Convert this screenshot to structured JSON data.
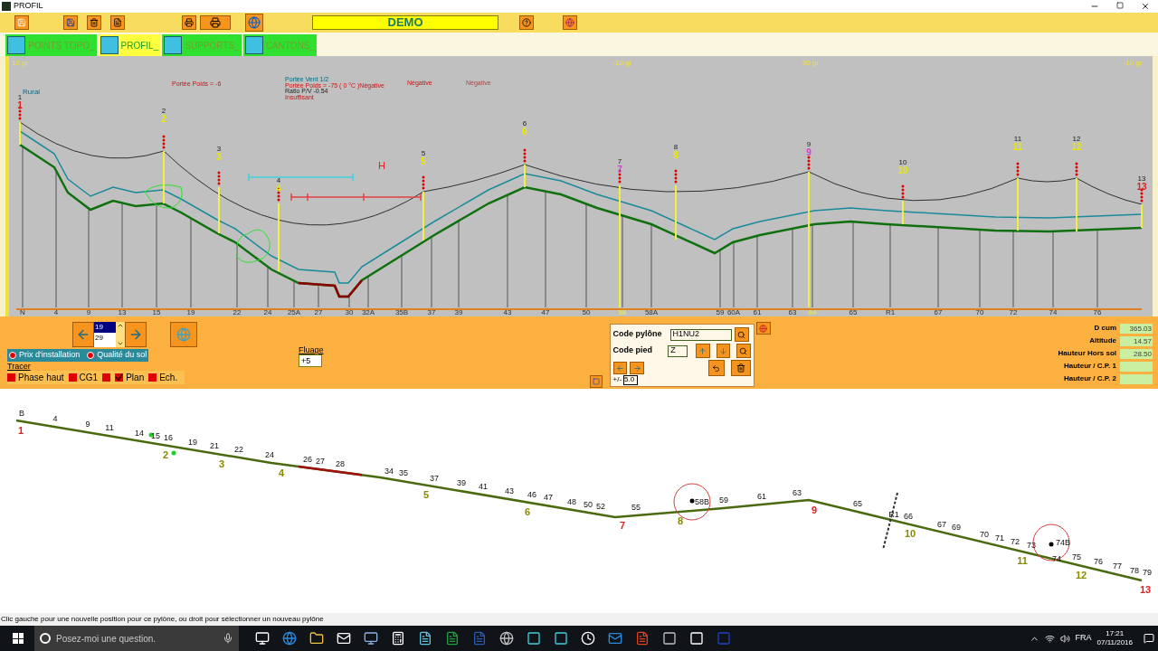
{
  "window": {
    "title": "PROFIL"
  },
  "toolbar": {
    "badge": "DEMO"
  },
  "tabs": [
    {
      "label": "POINTS TOPO_",
      "selected": false
    },
    {
      "label": "PROFIL_",
      "selected": true
    },
    {
      "label": "SUPPORTS_",
      "selected": false
    },
    {
      "label": "CANTONS_",
      "selected": false
    }
  ],
  "profile": {
    "grade_labels": [
      "10 gr",
      "-10 gr",
      "20 gr",
      "-10 gr"
    ],
    "annotations": [
      {
        "text": "Portée Poids = -6",
        "kind": "alert"
      },
      {
        "text": "Portée Vent 1/2",
        "kind": "wind"
      },
      {
        "text": "Portée Poids = -75  (  0 °C )Négative",
        "kind": "alert"
      },
      {
        "text": "Ratio P/V -0.54",
        "kind": "info"
      },
      {
        "text": "Insuffisant",
        "kind": "alert"
      },
      {
        "text": "Négative",
        "kind": "alert"
      },
      {
        "text": "Négative",
        "kind": "faint"
      }
    ],
    "zone_label": "Rural",
    "marker": "H",
    "towers": [
      {
        "number": "1",
        "code": "1",
        "color": "#e02020"
      },
      {
        "number": "2",
        "code": "2",
        "color": "#e8e800"
      },
      {
        "number": "3",
        "code": "3",
        "color": "#e8e800"
      },
      {
        "number": "4",
        "code": "4",
        "color": "#e8e800"
      },
      {
        "number": "5",
        "code": "5",
        "color": "#e8e800"
      },
      {
        "number": "6",
        "code": "6",
        "color": "#e8e800"
      },
      {
        "number": "7",
        "code": "7",
        "color": "#d040d0"
      },
      {
        "number": "8",
        "code": "8",
        "color": "#e8e800"
      },
      {
        "number": "9",
        "code": "9",
        "color": "#d040d0"
      },
      {
        "number": "10",
        "code": "10",
        "color": "#e8e800"
      },
      {
        "number": "11",
        "code": "11",
        "color": "#e8e800"
      },
      {
        "number": "12",
        "code": "12",
        "color": "#e8e800"
      },
      {
        "number": "13",
        "code": "13",
        "color": "#e02020"
      }
    ],
    "stations": [
      {
        "label": "N",
        "highlighted": false
      },
      {
        "label": "4",
        "highlighted": false
      },
      {
        "label": "9",
        "highlighted": false
      },
      {
        "label": "13",
        "highlighted": false
      },
      {
        "label": "15",
        "highlighted": false
      },
      {
        "label": "19",
        "highlighted": false
      },
      {
        "label": "22",
        "highlighted": false
      },
      {
        "label": "24",
        "highlighted": false
      },
      {
        "label": "25A",
        "highlighted": false
      },
      {
        "label": "27",
        "highlighted": false
      },
      {
        "label": "30",
        "highlighted": false
      },
      {
        "label": "32A",
        "highlighted": false
      },
      {
        "label": "35B",
        "highlighted": false
      },
      {
        "label": "37",
        "highlighted": false
      },
      {
        "label": "39",
        "highlighted": false
      },
      {
        "label": "43",
        "highlighted": false
      },
      {
        "label": "47",
        "highlighted": false
      },
      {
        "label": "50",
        "highlighted": false
      },
      {
        "label": "58",
        "highlighted": true
      },
      {
        "label": "58A",
        "highlighted": false
      },
      {
        "label": "59",
        "highlighted": false
      },
      {
        "label": "60A",
        "highlighted": false
      },
      {
        "label": "61",
        "highlighted": false
      },
      {
        "label": "63",
        "highlighted": false
      },
      {
        "label": "64",
        "highlighted": true
      },
      {
        "label": "65",
        "highlighted": false
      },
      {
        "label": "R1",
        "highlighted": false
      },
      {
        "label": "67",
        "highlighted": false
      },
      {
        "label": "70",
        "highlighted": false
      },
      {
        "label": "72",
        "highlighted": false
      },
      {
        "label": "74",
        "highlighted": false
      },
      {
        "label": "76",
        "highlighted": false
      }
    ]
  },
  "controls": {
    "tower_list": [
      {
        "value": "19",
        "selected": true
      },
      {
        "value": "29",
        "selected": false
      }
    ],
    "options": [
      {
        "label": "Prix d'installation",
        "on": true
      },
      {
        "label": "Qualité du sol",
        "on": true
      }
    ],
    "tracer": {
      "label": "Tracer",
      "checkboxes": [
        {
          "label": "Phase haut",
          "checked": false
        },
        {
          "label": "CG1",
          "checked": false
        },
        {
          "checked": false
        },
        {
          "label": "Plan",
          "checked": true
        },
        {
          "label": "Ech.",
          "checked": false
        }
      ]
    },
    "fluage": {
      "label": "Fluage",
      "value": "+5"
    }
  },
  "pylon_panel": {
    "code_pylone_label": "Code pylône",
    "code_pylone": "H1NU2",
    "code_pied_label": "Code pied",
    "code_pied": "Z",
    "tolerance_label": "+/-",
    "tolerance": "5.0"
  },
  "readouts": [
    {
      "label": "D cum",
      "value": "365.03"
    },
    {
      "label": "Altitude",
      "value": "14.57"
    },
    {
      "label": "Hauteur Hors sol",
      "value": "28.50"
    },
    {
      "label": "Hauteur / C.P. 1"
    },
    {
      "label": "Hauteur / C.P. 2"
    }
  ],
  "plan": {
    "points": [
      "B",
      "4",
      "9",
      "11",
      "14",
      "15",
      "16",
      "19",
      "21",
      "22",
      "24",
      "26",
      "27",
      "28",
      "34",
      "35",
      "37",
      "39",
      "41",
      "43",
      "46",
      "47",
      "48",
      "50",
      "52",
      "55",
      "58B",
      "59",
      "61",
      "63",
      "65",
      "66",
      "67",
      "69",
      "70",
      "71",
      "72",
      "73",
      "74B",
      "74",
      "75",
      "76",
      "77",
      "78",
      "79"
    ],
    "towers": [
      {
        "label": "1",
        "color": "#e02020"
      },
      {
        "label": "2",
        "color": "#8a8a00"
      },
      {
        "label": "3",
        "color": "#8a8a00"
      },
      {
        "label": "4",
        "color": "#8a8a00"
      },
      {
        "label": "5",
        "color": "#8a8a00"
      },
      {
        "label": "6",
        "color": "#8a8a00"
      },
      {
        "label": "7",
        "color": "#e02020"
      },
      {
        "label": "8",
        "color": "#8a8a00"
      },
      {
        "label": "9",
        "color": "#e02020"
      },
      {
        "label": "10",
        "color": "#8a8a00"
      },
      {
        "label": "11",
        "color": "#8a8a00"
      },
      {
        "label": "12",
        "color": "#8a8a00"
      },
      {
        "label": "13",
        "color": "#e02020"
      }
    ],
    "crossing": "R1"
  },
  "status_bar": "Clic gauche pour une nouvelle position pour ce pylône, ou droit pour sélectionner un nouveau pylône",
  "taskbar": {
    "search_placeholder": "Posez-moi une question.",
    "language": "FRA",
    "time": "17:21",
    "date": "07/11/2016"
  }
}
